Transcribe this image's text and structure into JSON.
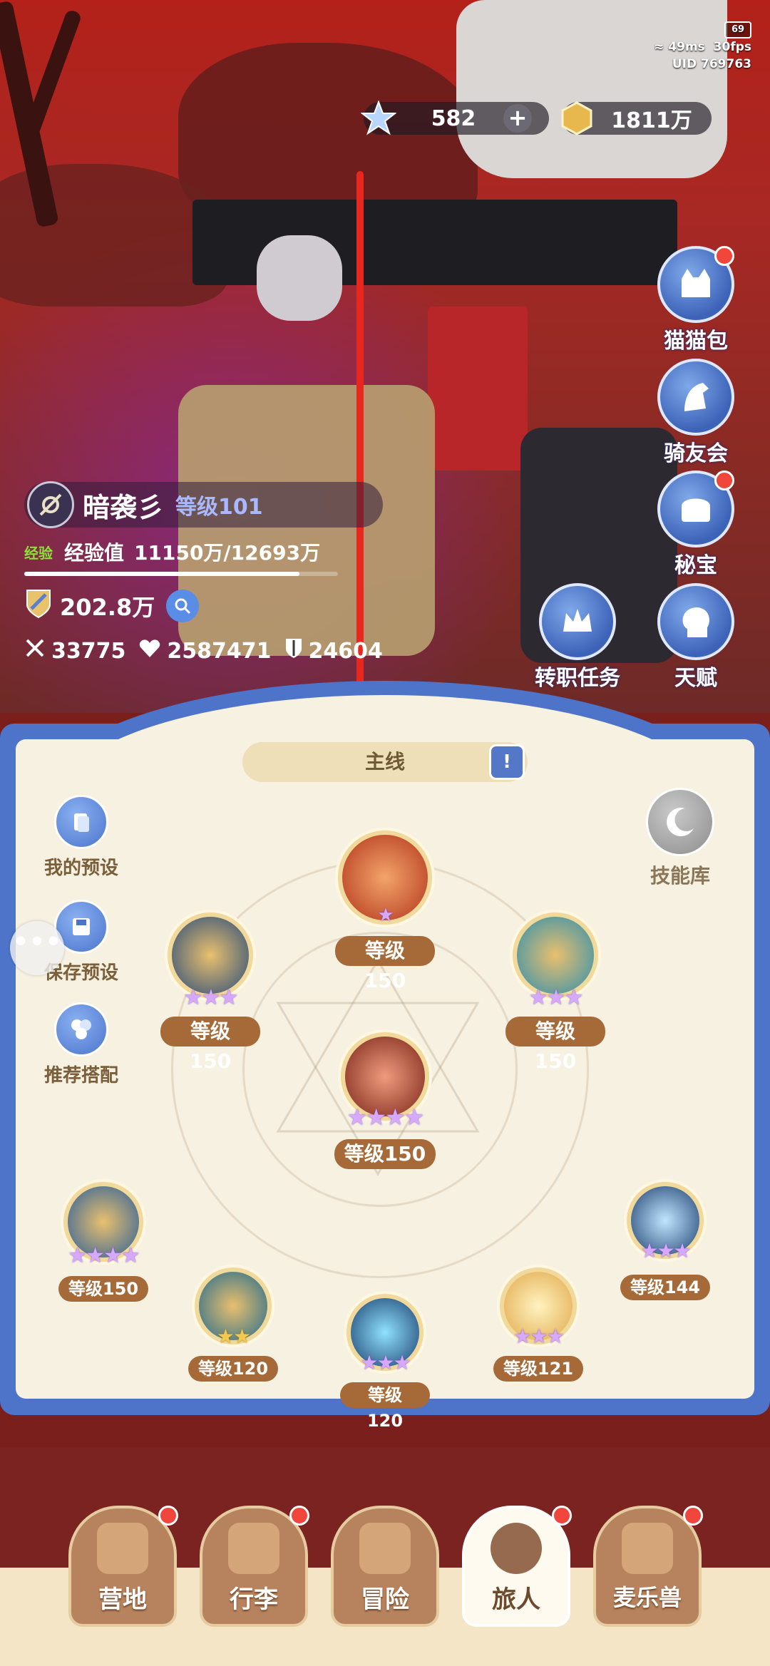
{
  "status": {
    "battery": "69",
    "ping": "49ms",
    "fps": "30fps",
    "uid": "UID 769763"
  },
  "currency": {
    "star_value": "582",
    "gold_value": "1811万"
  },
  "right_menu": {
    "cat_bag": "猫猫包",
    "rider_club": "骑友会",
    "treasure": "秘宝",
    "job_quest": "转职任务",
    "talent": "天赋"
  },
  "player": {
    "name": "暗袭彡",
    "level": "等级101",
    "exp_tag": "经验",
    "exp_label": "经验值",
    "exp_value": "11150万/12693万",
    "exp_ratio": 0.878,
    "power": "202.8万",
    "attack": "33775",
    "hp": "2587471",
    "defense": "24604"
  },
  "panel": {
    "tab_label": "主线",
    "tab_book_icon": "!",
    "my_preset": "我的预设",
    "save_preset": "保存预设",
    "recommend": "推荐搭配",
    "skill_library": "技能库"
  },
  "skills": [
    {
      "level": "等级150",
      "stars": "★"
    },
    {
      "level": "等级150",
      "stars": "★★★"
    },
    {
      "level": "等级150",
      "stars": "★★★"
    },
    {
      "level": "等级150",
      "stars": "★★★★"
    },
    {
      "level": "等级150",
      "stars": "★★★★"
    },
    {
      "level": "等级120",
      "stars": "★★"
    },
    {
      "level": "等级120",
      "stars": "★★★"
    },
    {
      "level": "等级121",
      "stars": "★★★"
    },
    {
      "level": "等级144",
      "stars": "★★★"
    }
  ],
  "nav": {
    "camp": "营地",
    "luggage": "行李",
    "adventure": "冒险",
    "traveler": "旅人",
    "beast": "麦乐兽"
  },
  "colors": {
    "accent": "#4d74c9",
    "panel": "#f7f1e2",
    "level_badge": "#a56a38",
    "notify": "#f0463c"
  }
}
